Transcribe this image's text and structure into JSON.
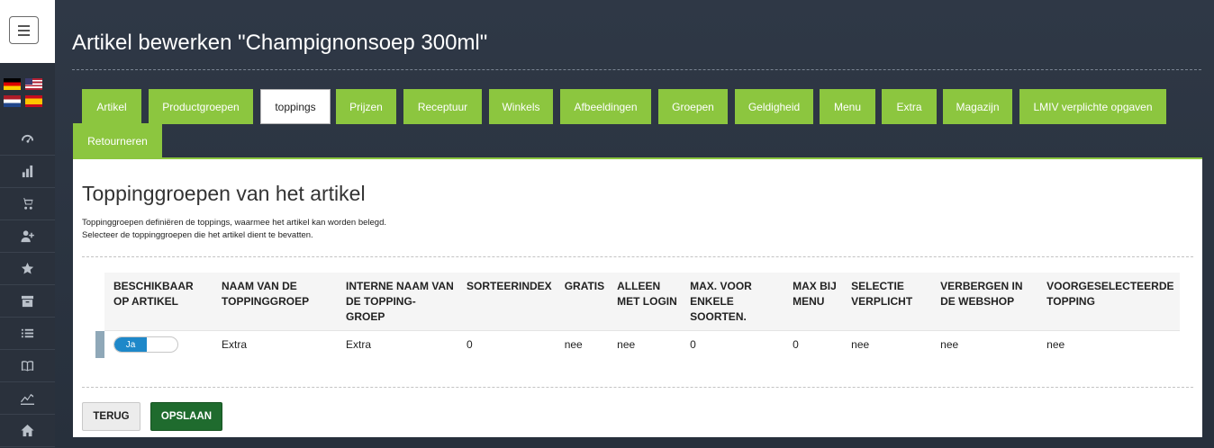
{
  "sidebar": {
    "menu_button_icon": "hamburger-icon",
    "flags": [
      "flag-de",
      "flag-us",
      "flag-nl",
      "flag-es"
    ],
    "icons": [
      "speedometer-icon",
      "bar-chart-icon",
      "cart-icon",
      "add-user-icon",
      "star-icon",
      "archive-icon",
      "list-icon",
      "book-icon",
      "trend-icon",
      "home-icon"
    ]
  },
  "header": {
    "title": "Artikel bewerken \"Champignonsoep 300ml\""
  },
  "tabs": [
    {
      "label": "Artikel",
      "active": false
    },
    {
      "label": "Productgroepen",
      "active": false
    },
    {
      "label": "toppings",
      "active": true
    },
    {
      "label": "Prijzen",
      "active": false
    },
    {
      "label": "Receptuur",
      "active": false
    },
    {
      "label": "Winkels",
      "active": false
    },
    {
      "label": "Afbeeldingen",
      "active": false
    },
    {
      "label": "Groepen",
      "active": false
    },
    {
      "label": "Geldigheid",
      "active": false
    },
    {
      "label": "Menu",
      "active": false
    },
    {
      "label": "Extra",
      "active": false
    },
    {
      "label": "Magazijn",
      "active": false
    },
    {
      "label": "LMIV verplichte opgaven",
      "active": false
    },
    {
      "label": "Retourneren",
      "active": false
    }
  ],
  "section": {
    "title": "Toppinggroepen van het artikel",
    "description_line1": "Toppinggroepen definiëren de toppings, waarmee het artikel kan worden belegd.",
    "description_line2": "Selecteer de toppinggroepen die het artikel dient te bevatten."
  },
  "table": {
    "headers": [
      "BESCHIKBAAR OP ARTIKEL",
      "NAAM VAN DE TOPPINGGROEP",
      "INTERNE NAAM VAN DE TOPPING-GROEP",
      "SORTEERINDEX",
      "GRATIS",
      "ALLEEN MET LOGIN",
      "MAX. VOOR ENKELE SOORTEN.",
      "MAX BIJ MENU",
      "SELECTIE VERPLICHT",
      "VERBERGEN IN DE WEBSHOP",
      "VOORGESELECTEERDE TOPPING"
    ],
    "rows": [
      [
        "Ja",
        "Extra",
        "Extra",
        "0",
        "nee",
        "nee",
        "0",
        "0",
        "nee",
        "nee",
        "nee"
      ]
    ]
  },
  "buttons": {
    "back": "TERUG",
    "save": "OPSLAAN"
  },
  "colors": {
    "tab_green": "#8cc63f",
    "save_green": "#1f6b2e",
    "toggle_blue": "#1e88c9"
  }
}
